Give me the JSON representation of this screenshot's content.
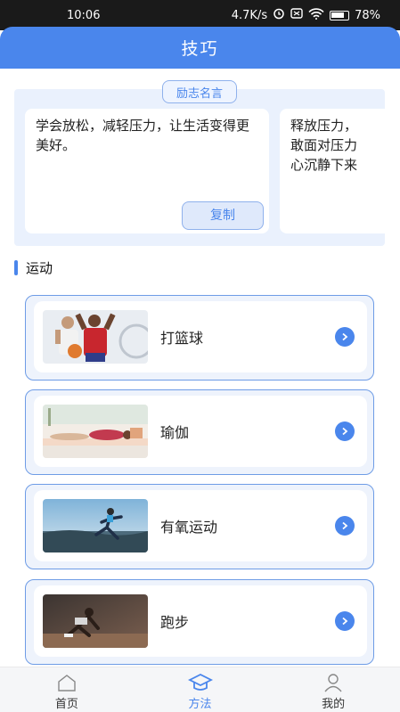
{
  "status_bar": {
    "time": "10:06",
    "net_speed": "4.7K/s",
    "battery": "78%"
  },
  "header": {
    "title": "技巧"
  },
  "quotes": {
    "tag": "励志名言",
    "cards": [
      {
        "text": "学会放松，减轻压力，让生活变得更美好。",
        "copy_label": "复制"
      },
      {
        "text_lines": [
          "释放压力，",
          "敢面对压力",
          "心沉静下来"
        ]
      }
    ]
  },
  "section": {
    "title": "运动"
  },
  "activities": [
    {
      "label": "打篮球",
      "image": "basketball-players"
    },
    {
      "label": "瑜伽",
      "image": "yoga-pose"
    },
    {
      "label": "有氧运动",
      "image": "outdoor-runner"
    },
    {
      "label": "跑步",
      "image": "sprinter-start"
    }
  ],
  "tabbar": {
    "items": [
      {
        "label": "首页",
        "icon": "home-icon"
      },
      {
        "label": "方法",
        "icon": "graduation-cap-icon"
      },
      {
        "label": "我的",
        "icon": "user-icon"
      }
    ],
    "active": "方法"
  },
  "colors": {
    "accent": "#4a86ec",
    "panel": "#eaf1fd"
  }
}
